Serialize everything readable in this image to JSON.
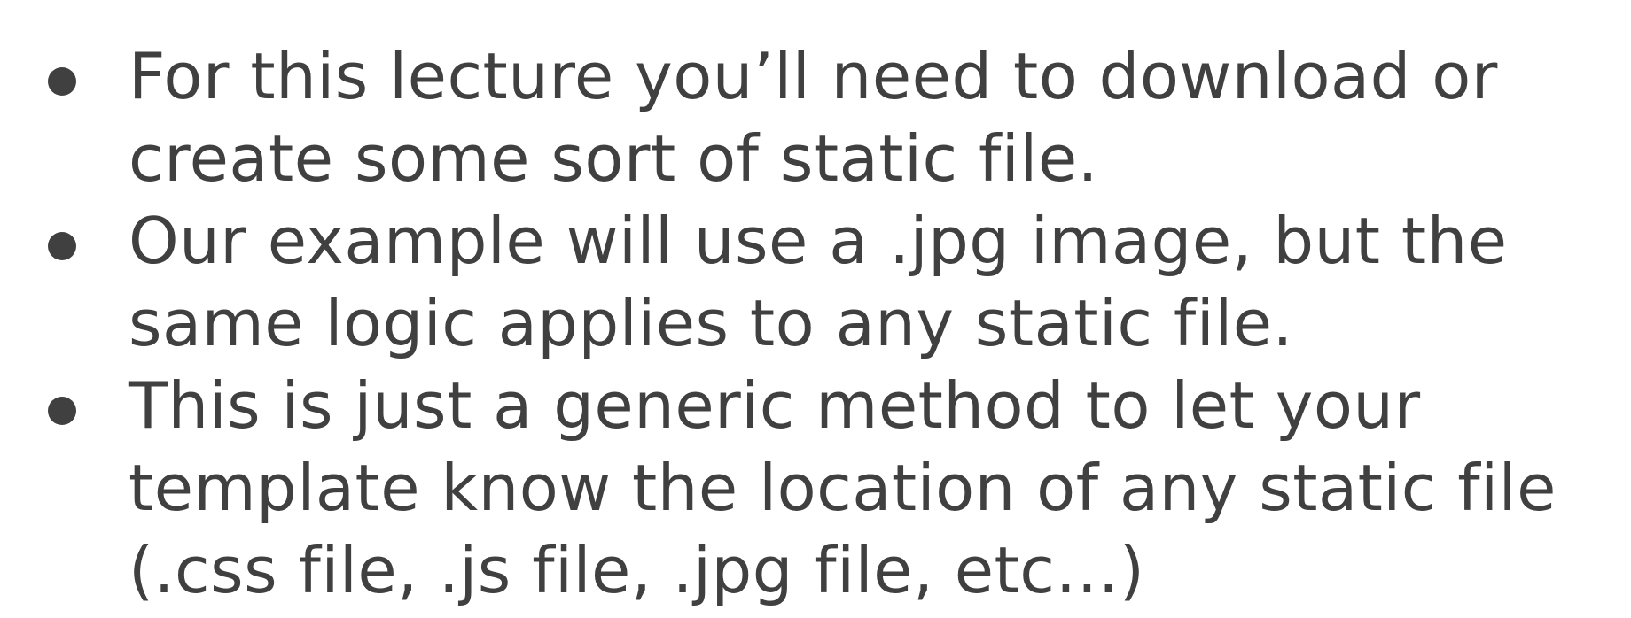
{
  "bullets": [
    {
      "text": "For this lecture you’ll need to download or create some sort of static file."
    },
    {
      "text": "Our example will use a .jpg image, but the same logic applies to any static file."
    },
    {
      "text": "This is just a generic method to let your template know the location of any static file (.css file, .js file, .jpg file, etc…)"
    }
  ],
  "colors": {
    "text": "#404040",
    "background": "#ffffff"
  }
}
